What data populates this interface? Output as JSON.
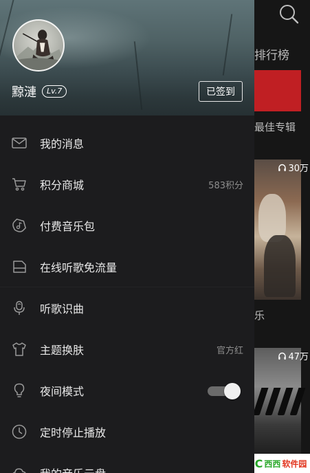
{
  "background": {
    "ranking_title": "排行榜",
    "album_label": "最佳专辑",
    "card1_count": "30万",
    "card2_count": "47万",
    "card1_tag": "乐"
  },
  "watermark": {
    "brand_green": "西西",
    "brand_red": "软件园"
  },
  "profile": {
    "username": "黥漣",
    "level": "Lv.7",
    "signin_label": "已签到"
  },
  "menu": {
    "items": [
      {
        "label": "我的消息",
        "icon": "mail-icon"
      },
      {
        "label": "积分商城",
        "icon": "cart-icon",
        "value": "583积分"
      },
      {
        "label": "付费音乐包",
        "icon": "music-tag-icon"
      },
      {
        "label": "在线听歌免流量",
        "icon": "sim-card-icon"
      },
      {
        "label": "听歌识曲",
        "icon": "mic-icon"
      },
      {
        "label": "主题换肤",
        "icon": "tshirt-icon",
        "value": "官方红"
      },
      {
        "label": "夜间模式",
        "icon": "bulb-icon",
        "toggle_on": true
      },
      {
        "label": "定时停止播放",
        "icon": "clock-icon"
      },
      {
        "label": "我的音乐云盘",
        "icon": "cloud-icon"
      }
    ]
  },
  "colors": {
    "drawer_bg": "#1c1c1e",
    "accent_red": "#c01f23",
    "text_primary": "#e8e8e8",
    "text_secondary": "#8e8e8e"
  }
}
